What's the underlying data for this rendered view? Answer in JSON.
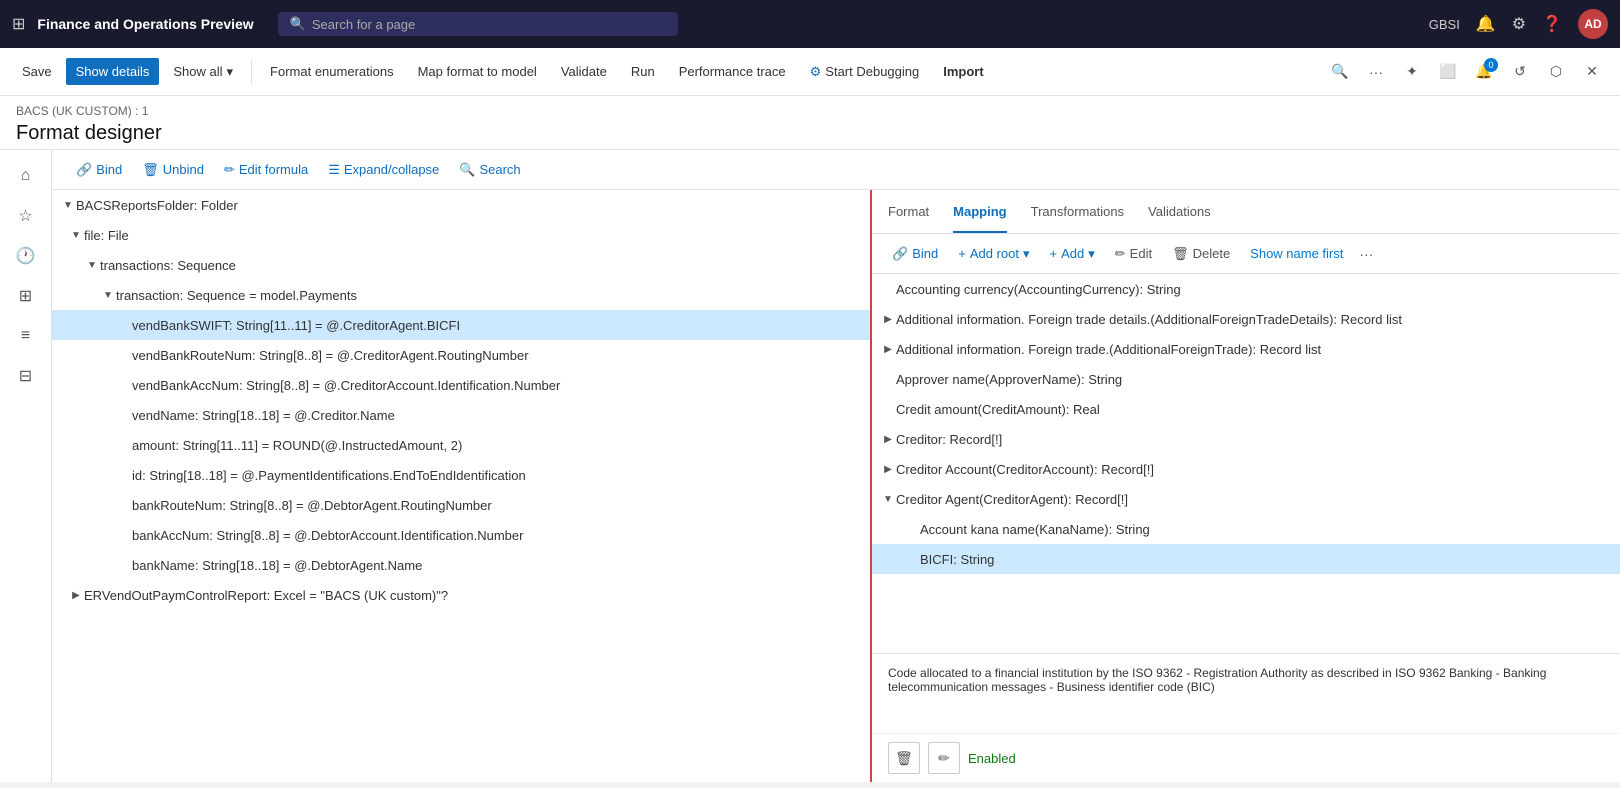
{
  "app": {
    "title": "Finance and Operations Preview",
    "search_placeholder": "Search for a page"
  },
  "top_nav": {
    "gbsi": "GBSI",
    "user_initials": "AD"
  },
  "toolbar": {
    "save_label": "Save",
    "show_details_label": "Show details",
    "show_all_label": "Show all",
    "format_enumerations_label": "Format enumerations",
    "map_format_to_model_label": "Map format to model",
    "validate_label": "Validate",
    "run_label": "Run",
    "performance_trace_label": "Performance trace",
    "start_debugging_label": "Start Debugging",
    "import_label": "Import"
  },
  "breadcrumb": "BACS (UK CUSTOM) : 1",
  "page_title": "Format designer",
  "format_toolbar": {
    "bind_label": "Bind",
    "unbind_label": "Unbind",
    "edit_formula_label": "Edit formula",
    "expand_collapse_label": "Expand/collapse",
    "search_label": "Search"
  },
  "tree": {
    "nodes": [
      {
        "id": "n1",
        "level": 1,
        "toggle": "open",
        "text": "BACSReportsFolder: Folder",
        "selected": false
      },
      {
        "id": "n2",
        "level": 2,
        "toggle": "open",
        "text": "file: File",
        "selected": false
      },
      {
        "id": "n3",
        "level": 3,
        "toggle": "open",
        "text": "transactions: Sequence",
        "selected": false
      },
      {
        "id": "n4",
        "level": 4,
        "toggle": "open",
        "text": "transaction: Sequence = model.Payments",
        "selected": false
      },
      {
        "id": "n5",
        "level": 5,
        "toggle": "leaf",
        "text": "vendBankSWIFT: String[11..11] = @.CreditorAgent.BICFI",
        "selected": true
      },
      {
        "id": "n6",
        "level": 5,
        "toggle": "leaf",
        "text": "vendBankRouteNum: String[8..8] = @.CreditorAgent.RoutingNumber",
        "selected": false
      },
      {
        "id": "n7",
        "level": 5,
        "toggle": "leaf",
        "text": "vendBankAccNum: String[8..8] = @.CreditorAccount.Identification.Number",
        "selected": false
      },
      {
        "id": "n8",
        "level": 5,
        "toggle": "leaf",
        "text": "vendName: String[18..18] = @.Creditor.Name",
        "selected": false
      },
      {
        "id": "n9",
        "level": 5,
        "toggle": "leaf",
        "text": "amount: String[11..11] = ROUND(@.InstructedAmount, 2)",
        "selected": false
      },
      {
        "id": "n10",
        "level": 5,
        "toggle": "leaf",
        "text": "id: String[18..18] = @.PaymentIdentifications.EndToEndIdentification",
        "selected": false
      },
      {
        "id": "n11",
        "level": 5,
        "toggle": "leaf",
        "text": "bankRouteNum: String[8..8] = @.DebtorAgent.RoutingNumber",
        "selected": false
      },
      {
        "id": "n12",
        "level": 5,
        "toggle": "leaf",
        "text": "bankAccNum: String[8..8] = @.DebtorAccount.Identification.Number",
        "selected": false
      },
      {
        "id": "n13",
        "level": 5,
        "toggle": "leaf",
        "text": "bankName: String[18..18] = @.DebtorAgent.Name",
        "selected": false
      },
      {
        "id": "n14",
        "level": 2,
        "toggle": "closed",
        "text": "ERVendOutPaymControlReport: Excel = \"BACS (UK custom)\"?",
        "selected": false
      }
    ]
  },
  "mapping_tabs": {
    "tabs": [
      {
        "id": "format",
        "label": "Format",
        "active": false
      },
      {
        "id": "mapping",
        "label": "Mapping",
        "active": true
      },
      {
        "id": "transformations",
        "label": "Transformations",
        "active": false
      },
      {
        "id": "validations",
        "label": "Validations",
        "active": false
      }
    ]
  },
  "mapping_toolbar": {
    "bind_label": "Bind",
    "add_root_label": "Add root",
    "add_label": "Add",
    "edit_label": "Edit",
    "delete_label": "Delete",
    "show_name_first_label": "Show name first"
  },
  "mapping_tree": {
    "nodes": [
      {
        "id": "m1",
        "level": 0,
        "toggle": "leaf",
        "text": "Accounting currency(AccountingCurrency): String",
        "selected": false
      },
      {
        "id": "m2",
        "level": 0,
        "toggle": "closed",
        "text": "Additional information. Foreign trade details.(AdditionalForeignTradeDetails): Record list",
        "selected": false
      },
      {
        "id": "m3",
        "level": 0,
        "toggle": "closed",
        "text": "Additional information. Foreign trade.(AdditionalForeignTrade): Record list",
        "selected": false
      },
      {
        "id": "m4",
        "level": 0,
        "toggle": "leaf",
        "text": "Approver name(ApproverName): String",
        "selected": false
      },
      {
        "id": "m5",
        "level": 0,
        "toggle": "leaf",
        "text": "Credit amount(CreditAmount): Real",
        "selected": false
      },
      {
        "id": "m6",
        "level": 0,
        "toggle": "closed",
        "text": "Creditor: Record[!]",
        "selected": false
      },
      {
        "id": "m7",
        "level": 0,
        "toggle": "closed",
        "text": "Creditor Account(CreditorAccount): Record[!]",
        "selected": false
      },
      {
        "id": "m8",
        "level": 0,
        "toggle": "open",
        "text": "Creditor Agent(CreditorAgent): Record[!]",
        "selected": false
      },
      {
        "id": "m9",
        "level": 1,
        "toggle": "leaf",
        "text": "Account kana name(KanaName): String",
        "selected": false
      },
      {
        "id": "m10",
        "level": 1,
        "toggle": "leaf",
        "text": "BICFI: String",
        "selected": true
      }
    ]
  },
  "description": {
    "text": "Code allocated to a financial institution by the ISO 9362 - Registration Authority as described in ISO 9362 Banking - Banking telecommunication messages - Business identifier code (BIC)",
    "status": "Enabled"
  }
}
